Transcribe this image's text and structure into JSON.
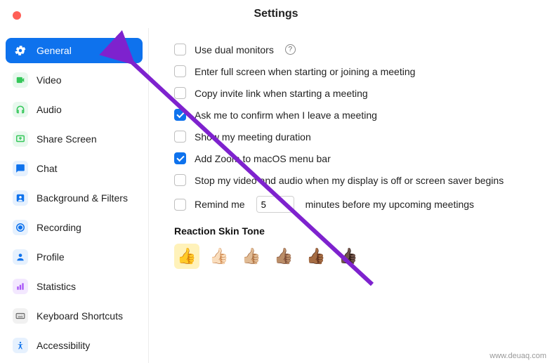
{
  "title": "Settings",
  "sidebar": {
    "items": [
      {
        "label": "General"
      },
      {
        "label": "Video"
      },
      {
        "label": "Audio"
      },
      {
        "label": "Share Screen"
      },
      {
        "label": "Chat"
      },
      {
        "label": "Background & Filters"
      },
      {
        "label": "Recording"
      },
      {
        "label": "Profile"
      },
      {
        "label": "Statistics"
      },
      {
        "label": "Keyboard Shortcuts"
      },
      {
        "label": "Accessibility"
      }
    ]
  },
  "general": {
    "dual_monitors": "Use dual monitors",
    "fullscreen": "Enter full screen when starting or joining a meeting",
    "copy_invite": "Copy invite link when starting a meeting",
    "confirm_leave": "Ask me to confirm when I leave a meeting",
    "show_duration": "Show my meeting duration",
    "menu_bar": "Add Zoom to macOS menu bar",
    "stop_av": "Stop my video and audio when my display is off or screen saver begins",
    "remind_pre": "Remind me",
    "remind_val": "5",
    "remind_post": "minutes before my upcoming meetings",
    "skin_title": "Reaction Skin Tone",
    "tones": [
      "👍",
      "👍🏻",
      "👍🏼",
      "👍🏽",
      "👍🏾",
      "👍🏿"
    ]
  },
  "watermark": "www.deuaq.com",
  "colors": {
    "accent": "#0e72ed",
    "arrow": "#7e22ce"
  }
}
